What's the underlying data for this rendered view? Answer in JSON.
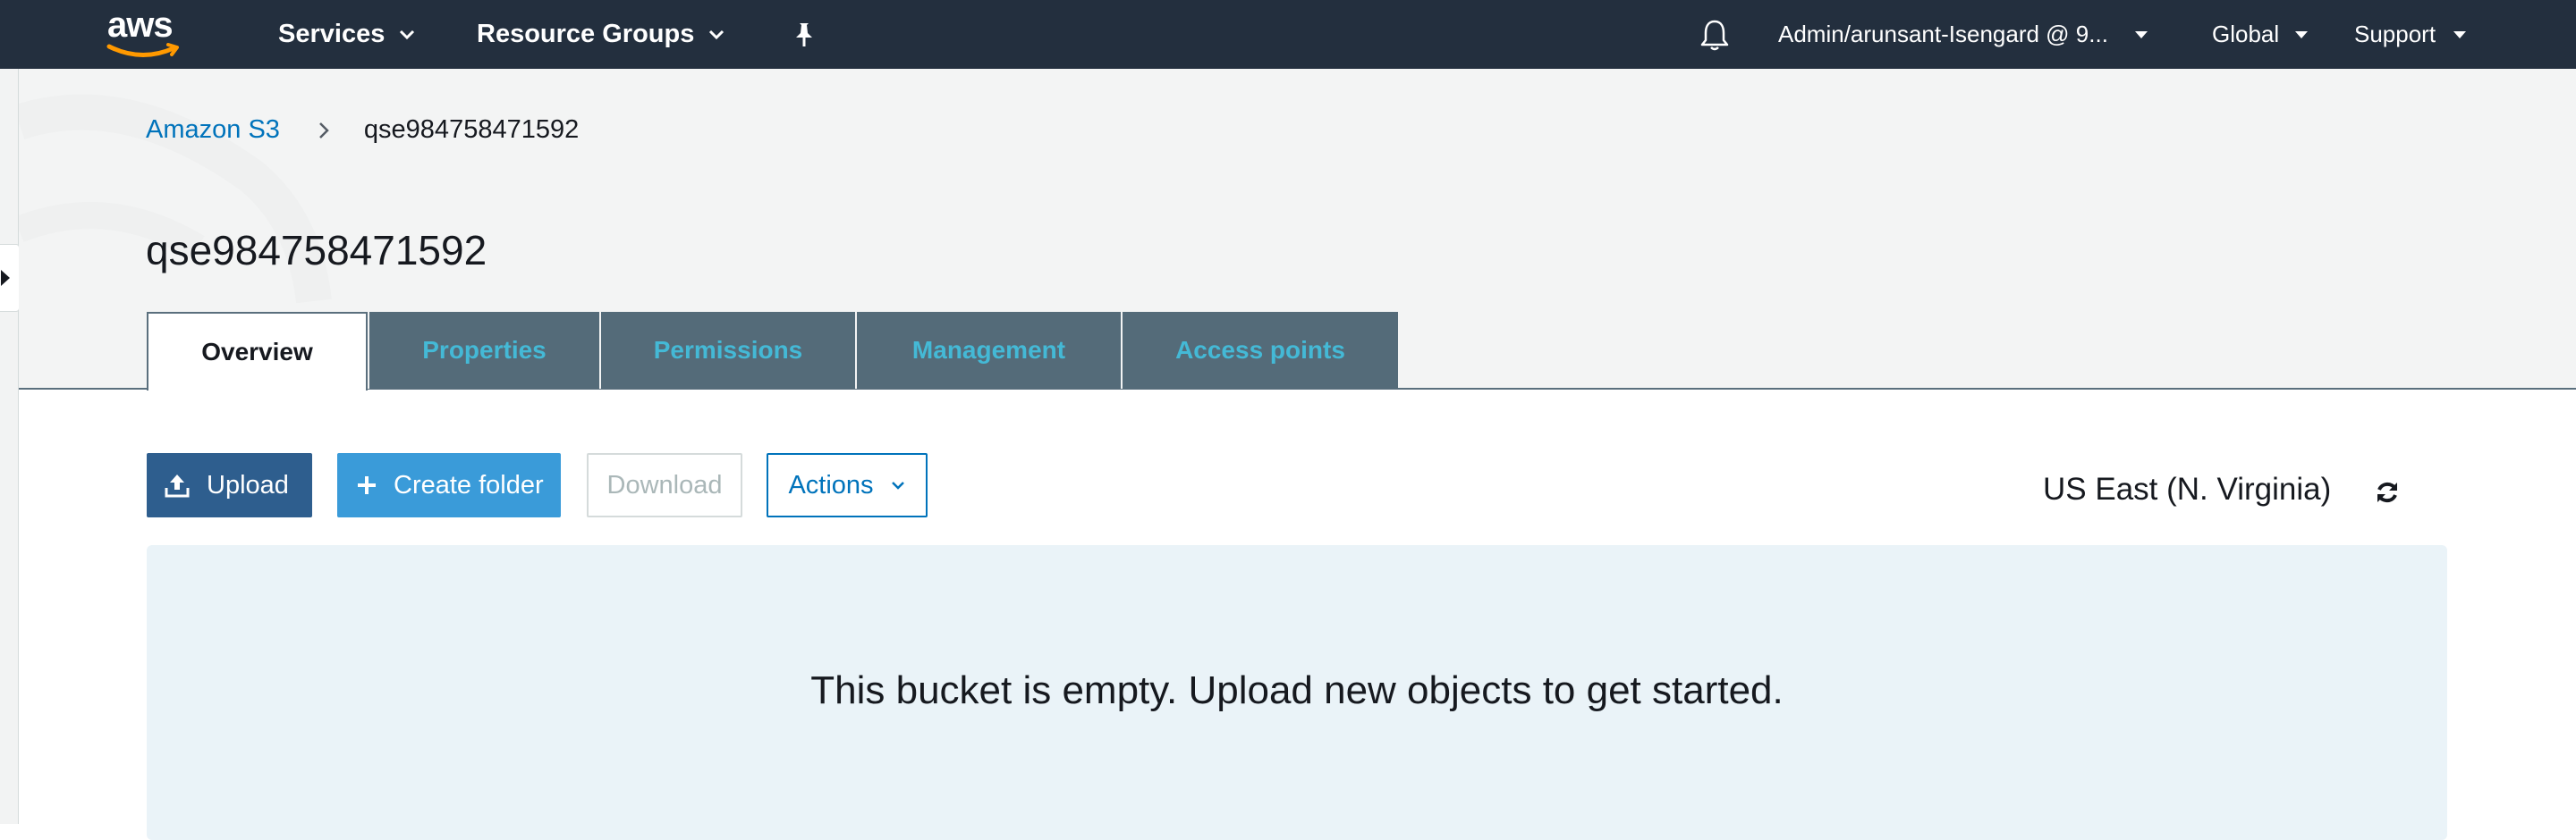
{
  "topnav": {
    "logo_text": "aws",
    "services_label": "Services",
    "resource_groups_label": "Resource Groups",
    "account_label": "Admin/arunsant-Isengard @ 9...",
    "region_menu_label": "Global",
    "support_label": "Support"
  },
  "breadcrumb": {
    "root": "Amazon S3",
    "current": "qse984758471592"
  },
  "page": {
    "title": "qse984758471592"
  },
  "tabs": [
    {
      "label": "Overview",
      "active": true
    },
    {
      "label": "Properties",
      "active": false
    },
    {
      "label": "Permissions",
      "active": false
    },
    {
      "label": "Management",
      "active": false
    },
    {
      "label": "Access points",
      "active": false
    }
  ],
  "toolbar": {
    "upload_label": "Upload",
    "create_folder_label": "Create folder",
    "download_label": "Download",
    "actions_label": "Actions",
    "region_text": "US East (N. Virginia)"
  },
  "empty_state": {
    "message": "This bucket is empty. Upload new objects to get started."
  },
  "colors": {
    "nav_bg": "#232f3e",
    "aws_orange": "#ff9900",
    "link_blue": "#0073bb",
    "tab_bg": "#546b79",
    "tab_text": "#44b9d6",
    "upload_bg": "#2e5e8e",
    "create_bg": "#3a9bd9",
    "panel_bg": "#eaf3f8"
  }
}
